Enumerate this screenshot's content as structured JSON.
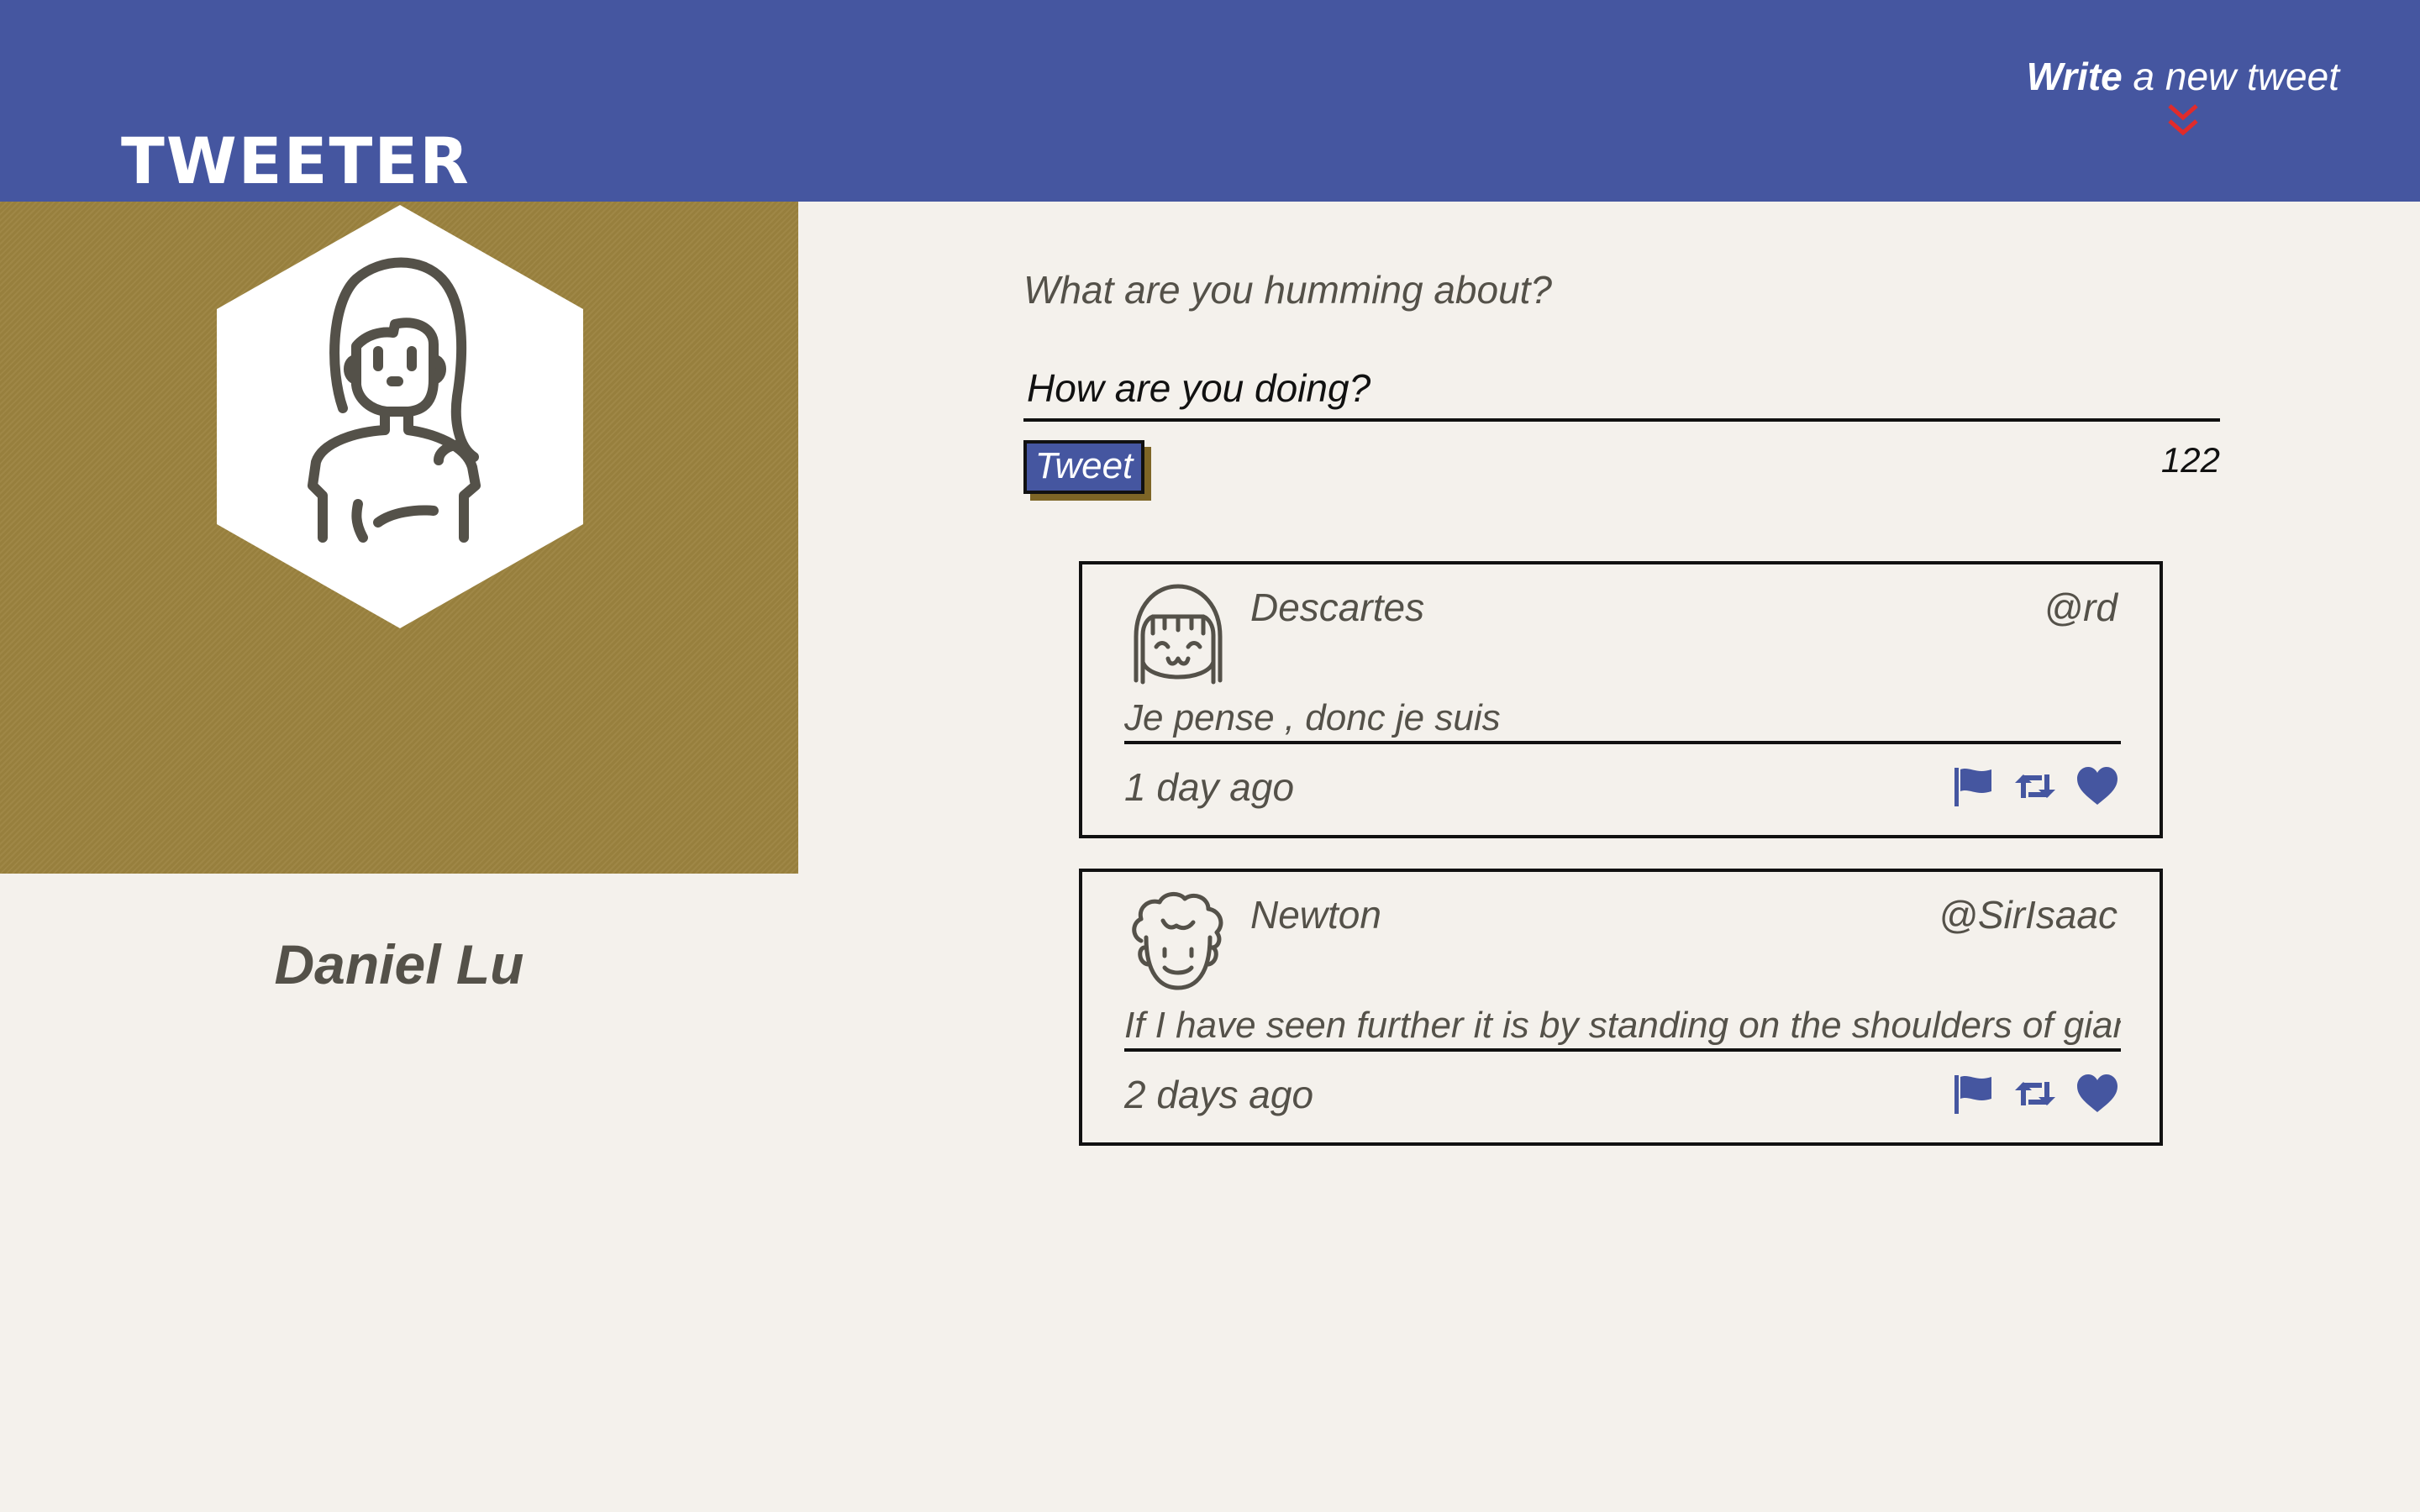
{
  "header": {
    "logo": "TWEETER",
    "compose_toggle": {
      "bold": "Write",
      "rest": " a new tweet",
      "icon": "double-chevron-down-icon",
      "icon_color": "#e02b2b"
    }
  },
  "profile": {
    "name": "Daniel Lu",
    "avatar_icon": "woman-avatar-icon"
  },
  "compose": {
    "label": "What are you humming about?",
    "value": "How are you doing?",
    "button_label": "Tweet",
    "char_count": "122"
  },
  "tweets": [
    {
      "name": "Descartes",
      "handle": "@rd",
      "text": "Je pense , donc je suis",
      "age": "1 day ago",
      "avatar_icon": "girl-avatar-icon"
    },
    {
      "name": "Newton",
      "handle": "@SirIsaac",
      "text": "If I have seen further it is by standing on the shoulders of giants",
      "age": "2 days ago",
      "avatar_icon": "curly-hair-avatar-icon"
    }
  ],
  "actions": [
    "flag-icon",
    "retweet-icon",
    "heart-icon"
  ],
  "colors": {
    "header": "#4556a0",
    "profile_panel": "#9c833f",
    "background": "#f4f1ec",
    "button": "#4556a0",
    "button_shadow": "#7d6526",
    "action_icons": "#4556a0"
  }
}
